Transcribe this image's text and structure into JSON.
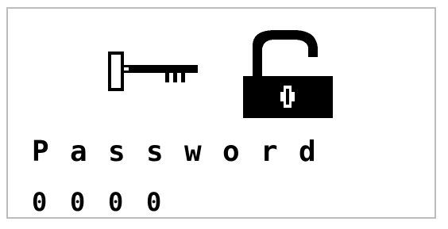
{
  "screen": {
    "label_text": "Password",
    "label_chars": [
      "P",
      "a",
      "s",
      "s",
      "w",
      "o",
      "r",
      "d"
    ],
    "value_text": "0000",
    "value_digits": [
      "0",
      "0",
      "0",
      "0"
    ]
  },
  "icons": {
    "key": "key-icon",
    "lock": "unlocked-padlock-icon"
  },
  "colors": {
    "foreground": "#000000",
    "background": "#ffffff",
    "frame": "#bdbdbd"
  }
}
